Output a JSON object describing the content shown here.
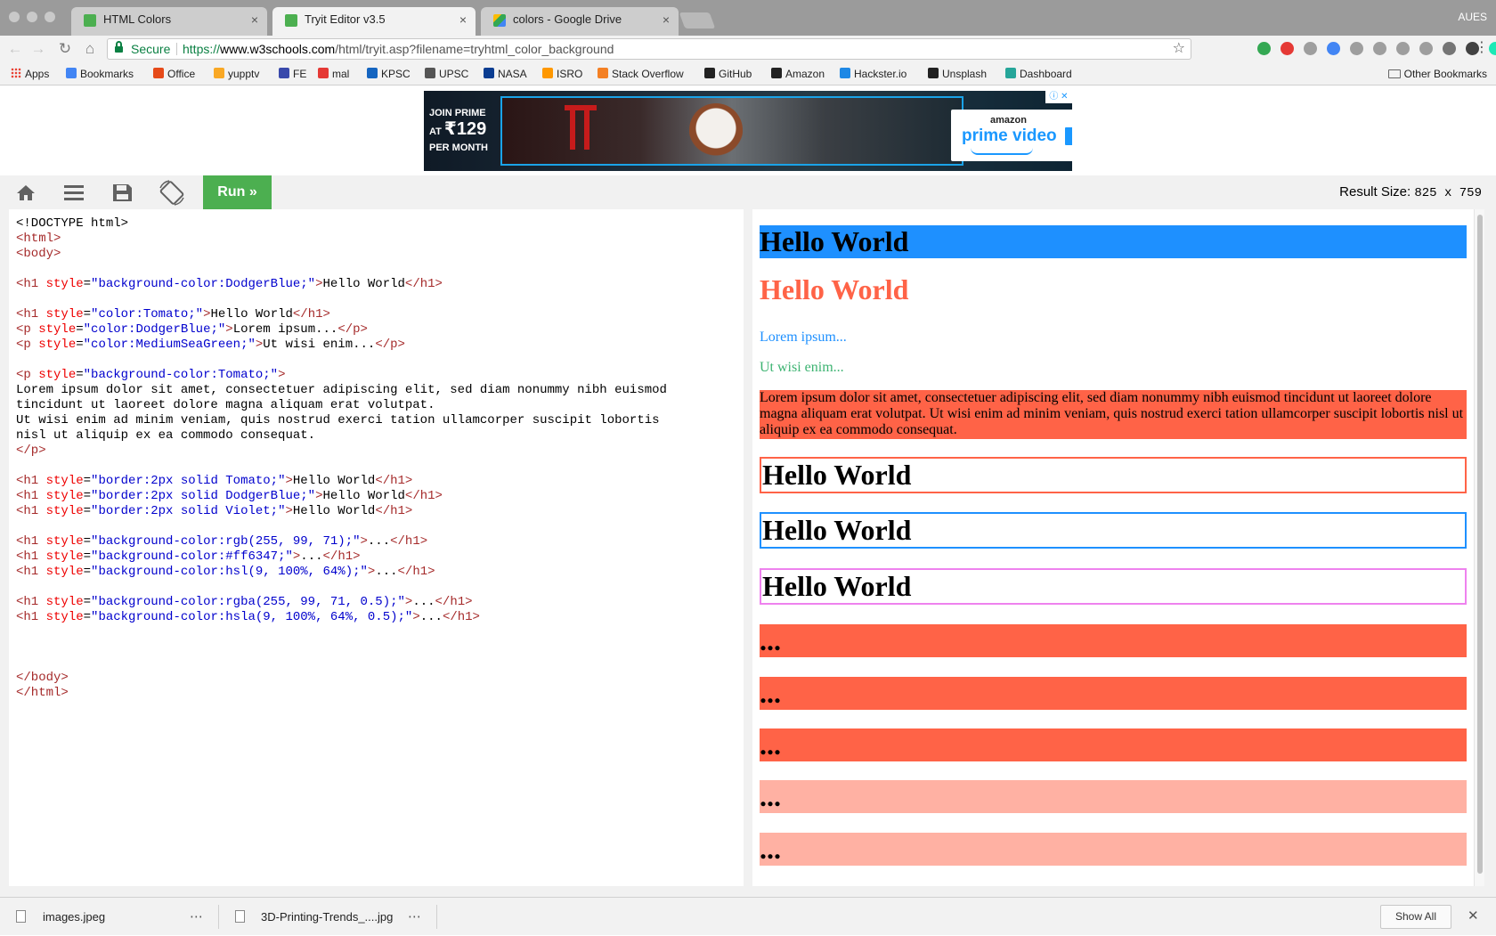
{
  "window": {
    "profile": "AUES",
    "tabs": [
      {
        "title": "HTML Colors",
        "favicon_color": "#4caf50",
        "active": false
      },
      {
        "title": "Tryit Editor v3.5",
        "favicon_color": "#4caf50",
        "active": true
      },
      {
        "title": "colors - Google Drive",
        "favicon_color": "#fbbc05",
        "active": false
      }
    ],
    "tab_close_glyph": "×"
  },
  "toolbar": {
    "back_glyph": "←",
    "forward_glyph": "→",
    "reload_glyph": "↻",
    "home_glyph": "⌂",
    "secure_label": "Secure",
    "url_scheme": "https://",
    "url_host": "www.w3schools.com",
    "url_path": "/html/tryit.asp?filename=tryhtml_color_background",
    "star_glyph": "☆",
    "menu_glyph": "⋮",
    "extension_colors": [
      "#34a853",
      "#e53935",
      "#9e9e9e",
      "#4285f4",
      "#9e9e9e",
      "#9e9e9e",
      "#9e9e9e",
      "#9e9e9e",
      "#757575",
      "#424242",
      "#1de9b6"
    ]
  },
  "bookmarks": {
    "items": [
      {
        "label": "Apps",
        "icon": "apps-grid-icon",
        "color": "#e94235"
      },
      {
        "label": "Bookmarks",
        "icon": "star-icon",
        "color": "#4285f4"
      },
      {
        "label": "Office",
        "icon": "office-icon",
        "color": "#e64a19"
      },
      {
        "label": "yupptv",
        "icon": "yupptv-icon",
        "color": "#f9a825"
      },
      {
        "label": "FE",
        "icon": "fe-icon",
        "color": "#3949ab"
      },
      {
        "label": "mal",
        "icon": "mal-icon",
        "color": "#e53935"
      },
      {
        "label": "KPSC",
        "icon": "kpsc-icon",
        "color": "#1565c0"
      },
      {
        "label": "UPSC",
        "icon": "upsc-icon",
        "color": "#555555"
      },
      {
        "label": "NASA",
        "icon": "nasa-icon",
        "color": "#0b3d91"
      },
      {
        "label": "ISRO",
        "icon": "isro-icon",
        "color": "#ff9800"
      },
      {
        "label": "Stack Overflow",
        "icon": "stackoverflow-icon",
        "color": "#f48024"
      },
      {
        "label": "GitHub",
        "icon": "github-icon",
        "color": "#222222"
      },
      {
        "label": "Amazon",
        "icon": "amazon-icon",
        "color": "#222222"
      },
      {
        "label": "Hackster.io",
        "icon": "hackster-icon",
        "color": "#1e88e5"
      },
      {
        "label": "Unsplash",
        "icon": "camera-icon",
        "color": "#222222"
      },
      {
        "label": "Dashboard",
        "icon": "dashboard-icon",
        "color": "#26a69a"
      }
    ],
    "other": "Other Bookmarks"
  },
  "ad": {
    "line1": "JOIN PRIME",
    "line2_prefix": "AT",
    "price": "₹129",
    "line3": "PER MONTH",
    "brand": "amazon",
    "product": "prime video",
    "cta": "Stream now",
    "choices": "ⓘ ✕"
  },
  "tryit": {
    "run_label": "Run »",
    "result_size_label": "Result Size:",
    "result_size_value": "825 x 759"
  },
  "code_lines": [
    [
      {
        "t": "tx",
        "s": "<!DOCTYPE html>"
      }
    ],
    [
      {
        "t": "tg",
        "s": "<html>"
      }
    ],
    [
      {
        "t": "tg",
        "s": "<body>"
      }
    ],
    [],
    [
      {
        "t": "tg",
        "s": "<h1"
      },
      {
        "t": "at",
        "s": " style"
      },
      {
        "t": "tx",
        "s": "="
      },
      {
        "t": "vl",
        "s": "\"background-color:DodgerBlue;\""
      },
      {
        "t": "tg",
        "s": ">"
      },
      {
        "t": "tx",
        "s": "Hello World"
      },
      {
        "t": "tg",
        "s": "</h1>"
      }
    ],
    [],
    [
      {
        "t": "tg",
        "s": "<h1"
      },
      {
        "t": "at",
        "s": " style"
      },
      {
        "t": "tx",
        "s": "="
      },
      {
        "t": "vl",
        "s": "\"color:Tomato;\""
      },
      {
        "t": "tg",
        "s": ">"
      },
      {
        "t": "tx",
        "s": "Hello World"
      },
      {
        "t": "tg",
        "s": "</h1>"
      }
    ],
    [
      {
        "t": "tg",
        "s": "<p"
      },
      {
        "t": "at",
        "s": " style"
      },
      {
        "t": "tx",
        "s": "="
      },
      {
        "t": "vl",
        "s": "\"color:DodgerBlue;\""
      },
      {
        "t": "tg",
        "s": ">"
      },
      {
        "t": "tx",
        "s": "Lorem ipsum..."
      },
      {
        "t": "tg",
        "s": "</p>"
      }
    ],
    [
      {
        "t": "tg",
        "s": "<p"
      },
      {
        "t": "at",
        "s": " style"
      },
      {
        "t": "tx",
        "s": "="
      },
      {
        "t": "vl",
        "s": "\"color:MediumSeaGreen;\""
      },
      {
        "t": "tg",
        "s": ">"
      },
      {
        "t": "tx",
        "s": "Ut wisi enim..."
      },
      {
        "t": "tg",
        "s": "</p>"
      }
    ],
    [],
    [
      {
        "t": "tg",
        "s": "<p"
      },
      {
        "t": "at",
        "s": " style"
      },
      {
        "t": "tx",
        "s": "="
      },
      {
        "t": "vl",
        "s": "\"background-color:Tomato;\""
      },
      {
        "t": "tg",
        "s": ">"
      }
    ],
    [
      {
        "t": "tx",
        "s": "Lorem ipsum dolor sit amet, consectetuer adipiscing elit, sed diam nonummy nibh euismod"
      }
    ],
    [
      {
        "t": "tx",
        "s": "tincidunt ut laoreet dolore magna aliquam erat volutpat."
      }
    ],
    [
      {
        "t": "tx",
        "s": "Ut wisi enim ad minim veniam, quis nostrud exerci tation ullamcorper suscipit lobortis"
      }
    ],
    [
      {
        "t": "tx",
        "s": "nisl ut aliquip ex ea commodo consequat."
      }
    ],
    [
      {
        "t": "tg",
        "s": "</p>"
      }
    ],
    [],
    [
      {
        "t": "tg",
        "s": "<h1"
      },
      {
        "t": "at",
        "s": " style"
      },
      {
        "t": "tx",
        "s": "="
      },
      {
        "t": "vl",
        "s": "\"border:2px solid Tomato;\""
      },
      {
        "t": "tg",
        "s": ">"
      },
      {
        "t": "tx",
        "s": "Hello World"
      },
      {
        "t": "tg",
        "s": "</h1>"
      }
    ],
    [
      {
        "t": "tg",
        "s": "<h1"
      },
      {
        "t": "at",
        "s": " style"
      },
      {
        "t": "tx",
        "s": "="
      },
      {
        "t": "vl",
        "s": "\"border:2px solid DodgerBlue;\""
      },
      {
        "t": "tg",
        "s": ">"
      },
      {
        "t": "tx",
        "s": "Hello World"
      },
      {
        "t": "tg",
        "s": "</h1>"
      }
    ],
    [
      {
        "t": "tg",
        "s": "<h1"
      },
      {
        "t": "at",
        "s": " style"
      },
      {
        "t": "tx",
        "s": "="
      },
      {
        "t": "vl",
        "s": "\"border:2px solid Violet;\""
      },
      {
        "t": "tg",
        "s": ">"
      },
      {
        "t": "tx",
        "s": "Hello World"
      },
      {
        "t": "tg",
        "s": "</h1>"
      }
    ],
    [],
    [
      {
        "t": "tg",
        "s": "<h1"
      },
      {
        "t": "at",
        "s": " style"
      },
      {
        "t": "tx",
        "s": "="
      },
      {
        "t": "vl",
        "s": "\"background-color:rgb(255, 99, 71);\""
      },
      {
        "t": "tg",
        "s": ">"
      },
      {
        "t": "tx",
        "s": "..."
      },
      {
        "t": "tg",
        "s": "</h1>"
      }
    ],
    [
      {
        "t": "tg",
        "s": "<h1"
      },
      {
        "t": "at",
        "s": " style"
      },
      {
        "t": "tx",
        "s": "="
      },
      {
        "t": "vl",
        "s": "\"background-color:#ff6347;\""
      },
      {
        "t": "tg",
        "s": ">"
      },
      {
        "t": "tx",
        "s": "..."
      },
      {
        "t": "tg",
        "s": "</h1>"
      }
    ],
    [
      {
        "t": "tg",
        "s": "<h1"
      },
      {
        "t": "at",
        "s": " style"
      },
      {
        "t": "tx",
        "s": "="
      },
      {
        "t": "vl",
        "s": "\"background-color:hsl(9, 100%, 64%);\""
      },
      {
        "t": "tg",
        "s": ">"
      },
      {
        "t": "tx",
        "s": "..."
      },
      {
        "t": "tg",
        "s": "</h1>"
      }
    ],
    [],
    [
      {
        "t": "tg",
        "s": "<h1"
      },
      {
        "t": "at",
        "s": " style"
      },
      {
        "t": "tx",
        "s": "="
      },
      {
        "t": "vl",
        "s": "\"background-color:rgba(255, 99, 71, 0.5);\""
      },
      {
        "t": "tg",
        "s": ">"
      },
      {
        "t": "tx",
        "s": "..."
      },
      {
        "t": "tg",
        "s": "</h1>"
      }
    ],
    [
      {
        "t": "tg",
        "s": "<h1"
      },
      {
        "t": "at",
        "s": " style"
      },
      {
        "t": "tx",
        "s": "="
      },
      {
        "t": "vl",
        "s": "\"background-color:hsla(9, 100%, 64%, 0.5);\""
      },
      {
        "t": "tg",
        "s": ">"
      },
      {
        "t": "tx",
        "s": "..."
      },
      {
        "t": "tg",
        "s": "</h1>"
      }
    ],
    [],
    [],
    [],
    [
      {
        "t": "tg",
        "s": "</body>"
      }
    ],
    [
      {
        "t": "tg",
        "s": "</html>"
      }
    ]
  ],
  "result": {
    "h1_blue_bg": "Hello World",
    "h1_tomato": "Hello World",
    "p_blue": "Lorem ipsum...",
    "p_green": "Ut wisi enim...",
    "p_tomato_bg": "Lorem ipsum dolor sit amet, consectetuer adipiscing elit, sed diam nonummy nibh euismod tincidunt ut laoreet dolore magna aliquam erat volutpat. Ut wisi enim ad minim veniam, quis nostrud exerci tation ullamcorper suscipit lobortis nisl ut aliquip ex ea commodo consequat.",
    "h1_border_tomato": "Hello World",
    "h1_border_blue": "Hello World",
    "h1_border_violet": "Hello World",
    "dots": "...",
    "colors": {
      "dodgerblue": "#1e90ff",
      "tomato": "#ff6347",
      "mediumseagreen": "#3cb371",
      "violet": "#ee82ee",
      "tomato_half": "rgba(255, 99, 71, 0.5)"
    }
  },
  "downloads": {
    "items": [
      {
        "name": "images.jpeg"
      },
      {
        "name": "3D-Printing-Trends_....jpg"
      }
    ],
    "more_glyph": "⋯",
    "show_all": "Show All",
    "close_glyph": "✕"
  }
}
